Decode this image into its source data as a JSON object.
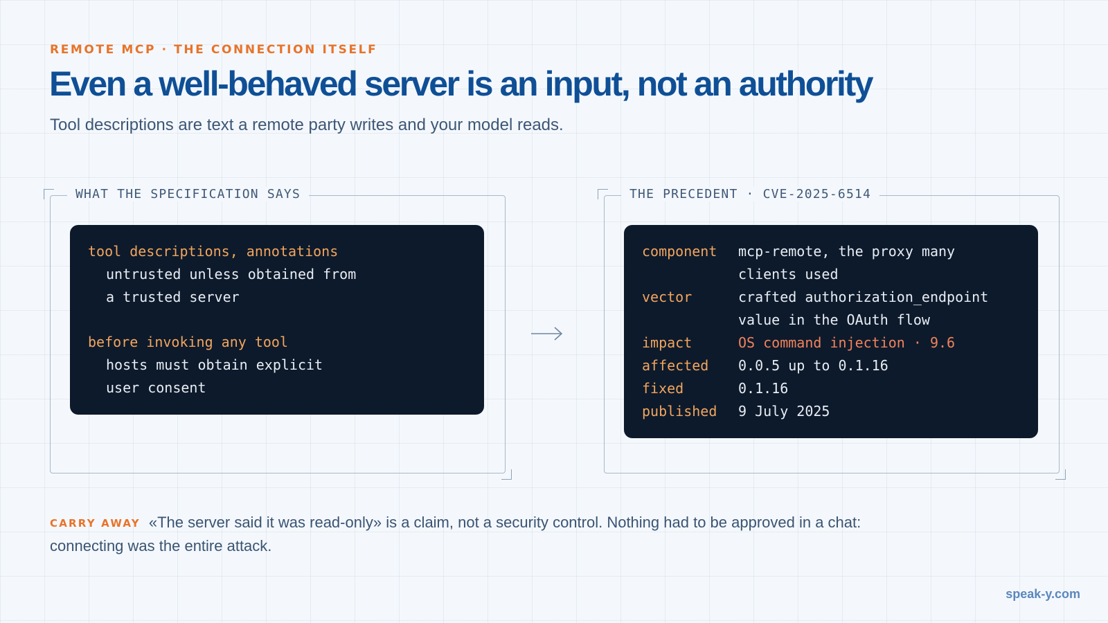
{
  "header": {
    "eyebrow": "REMOTE MCP · THE CONNECTION ITSELF",
    "title": "Even a well-behaved server is an input, not an authority",
    "subtitle": "Tool descriptions are text a remote party writes and your model reads."
  },
  "left_panel": {
    "label": "WHAT THE SPECIFICATION SAYS",
    "blocks": [
      {
        "key": "tool descriptions, annotations",
        "lines": [
          "untrusted unless obtained from",
          "a trusted server"
        ]
      },
      {
        "key": "before invoking any tool",
        "lines": [
          "hosts must obtain explicit",
          "user consent"
        ]
      }
    ]
  },
  "right_panel": {
    "label": "THE PRECEDENT · CVE-2025-6514",
    "rows": [
      {
        "key": "component",
        "lines": [
          "mcp-remote, the proxy many",
          "clients used"
        ]
      },
      {
        "key": "vector",
        "lines": [
          "crafted authorization_endpoint",
          "value in the OAuth flow"
        ]
      },
      {
        "key": "impact",
        "lines": [
          "OS command injection · 9.6"
        ]
      },
      {
        "key": "affected",
        "lines": [
          "0.0.5 up to 0.1.16"
        ]
      },
      {
        "key": "fixed",
        "lines": [
          "0.1.16"
        ]
      },
      {
        "key": "published",
        "lines": [
          "9 July 2025"
        ]
      }
    ]
  },
  "carry_away": {
    "label": "CARRY AWAY",
    "text": "«The server said it was read-only» is a claim, not a security control. Nothing had to be approved in a chat: connecting was the entire attack."
  },
  "footer": {
    "site": "speak-y.com"
  },
  "colors": {
    "accent": "#e8732a",
    "title": "#0f4f96",
    "code_bg": "#0d1a2b",
    "code_key": "#f2a55e",
    "code_alert": "#f2825c",
    "link": "#5b87bd"
  },
  "icons": {
    "connector": "arrow-right-icon"
  }
}
